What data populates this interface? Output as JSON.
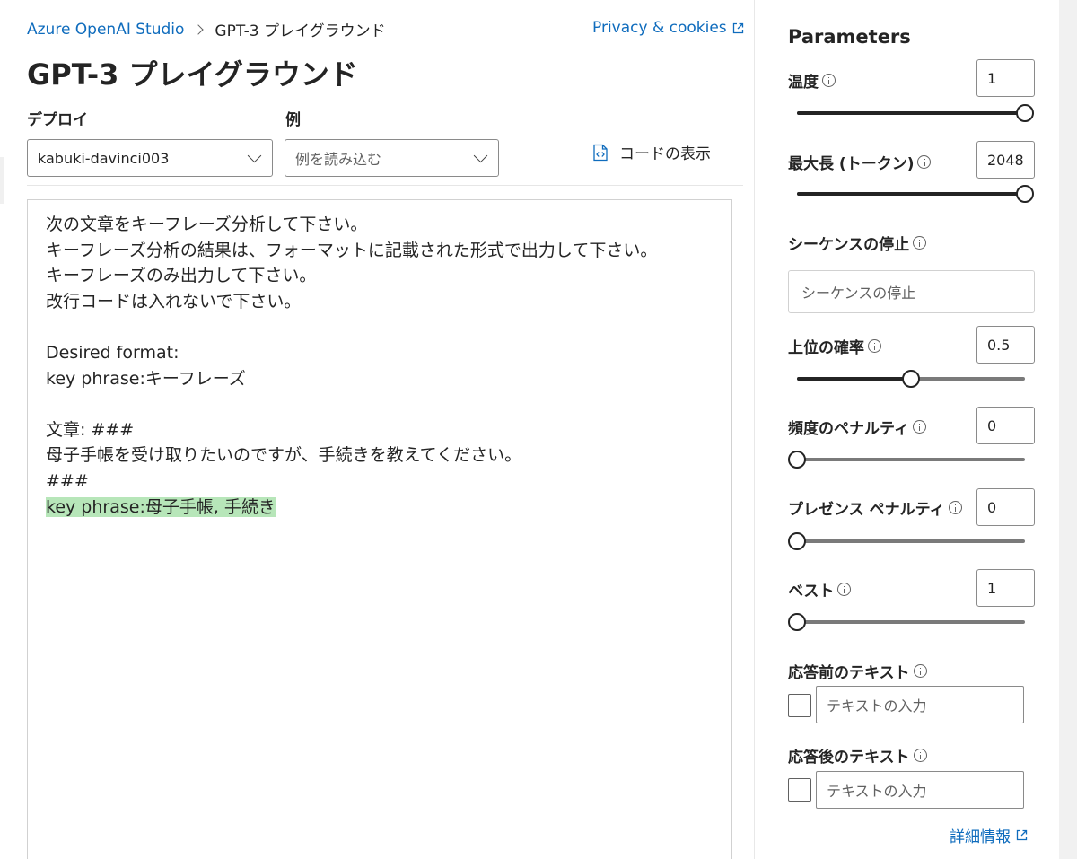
{
  "breadcrumb": {
    "root": "Azure OpenAI Studio",
    "current": "GPT-3 プレイグラウンド"
  },
  "header": {
    "privacy_link": "Privacy & cookies",
    "title": "GPT-3 プレイグラウンド"
  },
  "deploy": {
    "label": "デプロイ",
    "value": "kabuki-davinci003"
  },
  "examples": {
    "label": "例",
    "placeholder": "例を読み込む"
  },
  "view_code": {
    "label": "コードの表示"
  },
  "editor": {
    "lines": [
      "次の文章をキーフレーズ分析して下さい。",
      "キーフレーズ分析の結果は、フォーマットに記載された形式で出力して下さい。",
      "キーフレーズのみ出力して下さい。",
      "改行コードは入れないで下さい。",
      "",
      "Desired format:",
      "key phrase:キーフレーズ",
      "",
      "文章: ###",
      "母子手帳を受け取りたいのですが、手続きを教えてください。",
      "###"
    ],
    "generated": "key phrase:母子手帳, 手続き"
  },
  "parameters": {
    "title": "Parameters",
    "temperature": {
      "label": "温度",
      "value": "1",
      "fraction": 1.0
    },
    "max_length": {
      "label": "最大長 (トークン)",
      "value": "2048",
      "fraction": 1.0
    },
    "stop_sequence": {
      "label": "シーケンスの停止",
      "placeholder": "シーケンスの停止"
    },
    "top_p": {
      "label": "上位の確率",
      "value": "0.5",
      "fraction": 0.5
    },
    "frequency_penalty": {
      "label": "頻度のペナルティ",
      "value": "0",
      "fraction": 0.0
    },
    "presence_penalty": {
      "label": "プレゼンス ペナルティ",
      "value": "0",
      "fraction": 0.0
    },
    "best_of": {
      "label": "ベスト",
      "value": "1",
      "fraction": 0.0
    },
    "pre_response": {
      "label": "応答前のテキスト",
      "placeholder": "テキストの入力"
    },
    "post_response": {
      "label": "応答後のテキスト",
      "placeholder": "テキストの入力"
    },
    "details_link": "詳細情報"
  },
  "colors": {
    "link": "#0f6cbd",
    "highlight": "#b7e6b9",
    "text": "#242424"
  }
}
